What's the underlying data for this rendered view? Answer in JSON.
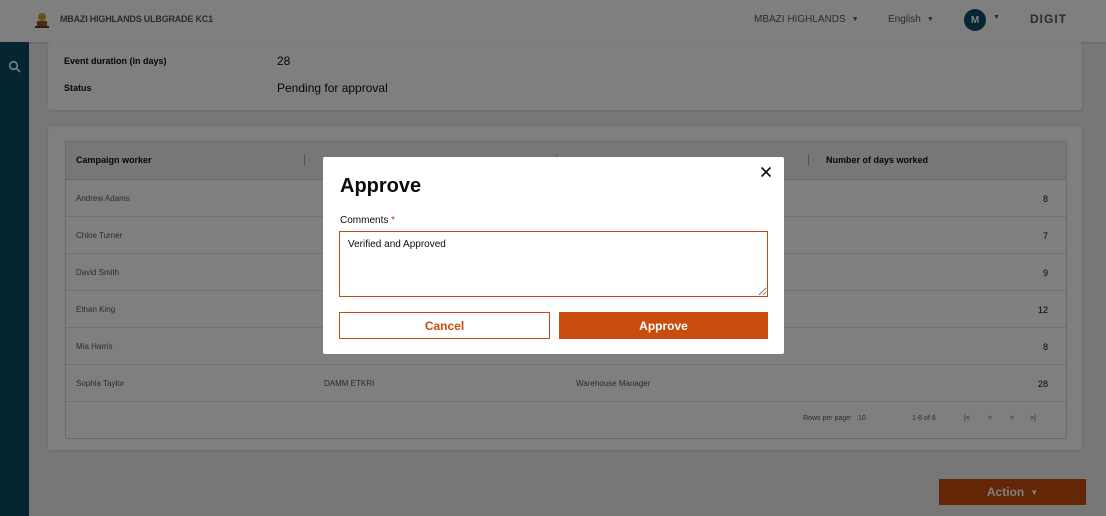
{
  "header": {
    "brand_name": "MBAZI HIGHLANDS ULBGRADE KC1",
    "tenant": "MBAZI HIGHLANDS",
    "language": "English",
    "avatar_initial": "M",
    "digit_logo": "DIGIT"
  },
  "details": [
    {
      "label": "Event duration (in days)",
      "value": "28"
    },
    {
      "label": "Status",
      "value": "Pending for approval"
    }
  ],
  "table": {
    "columns": [
      "Campaign worker",
      "",
      "",
      "Number of days worked"
    ],
    "rows": [
      {
        "name": "Andrew Adams",
        "id": "",
        "role": "",
        "days": "8"
      },
      {
        "name": "Chloe Turner",
        "id": "",
        "role": "",
        "days": "7"
      },
      {
        "name": "David Smith",
        "id": "",
        "role": "",
        "days": "9"
      },
      {
        "name": "Ethan King",
        "id": "",
        "role": "",
        "days": "12"
      },
      {
        "name": "Mia Harris",
        "id": "",
        "role": "",
        "days": "8"
      },
      {
        "name": "Sophia Taylor",
        "id": "DAMM ETKRI",
        "role": "Warehouse Manager",
        "days": "28"
      }
    ],
    "pagination": {
      "rows_per_page_label": "Rows per page:",
      "rows_per_page_value": "10",
      "range": "1-6 of 6"
    }
  },
  "action_button": {
    "label": "Action"
  },
  "modal": {
    "title": "Approve",
    "comments_label": "Comments",
    "required_marker": "*",
    "comments_value": "Verified and Approved",
    "cancel_label": "Cancel",
    "approve_label": "Approve"
  },
  "colors": {
    "primary": "#c84c0e",
    "sidebar": "#0b4b66"
  },
  "icons": [
    "brand-emblem-icon",
    "search-icon",
    "close-icon",
    "chevron-down-icon"
  ]
}
